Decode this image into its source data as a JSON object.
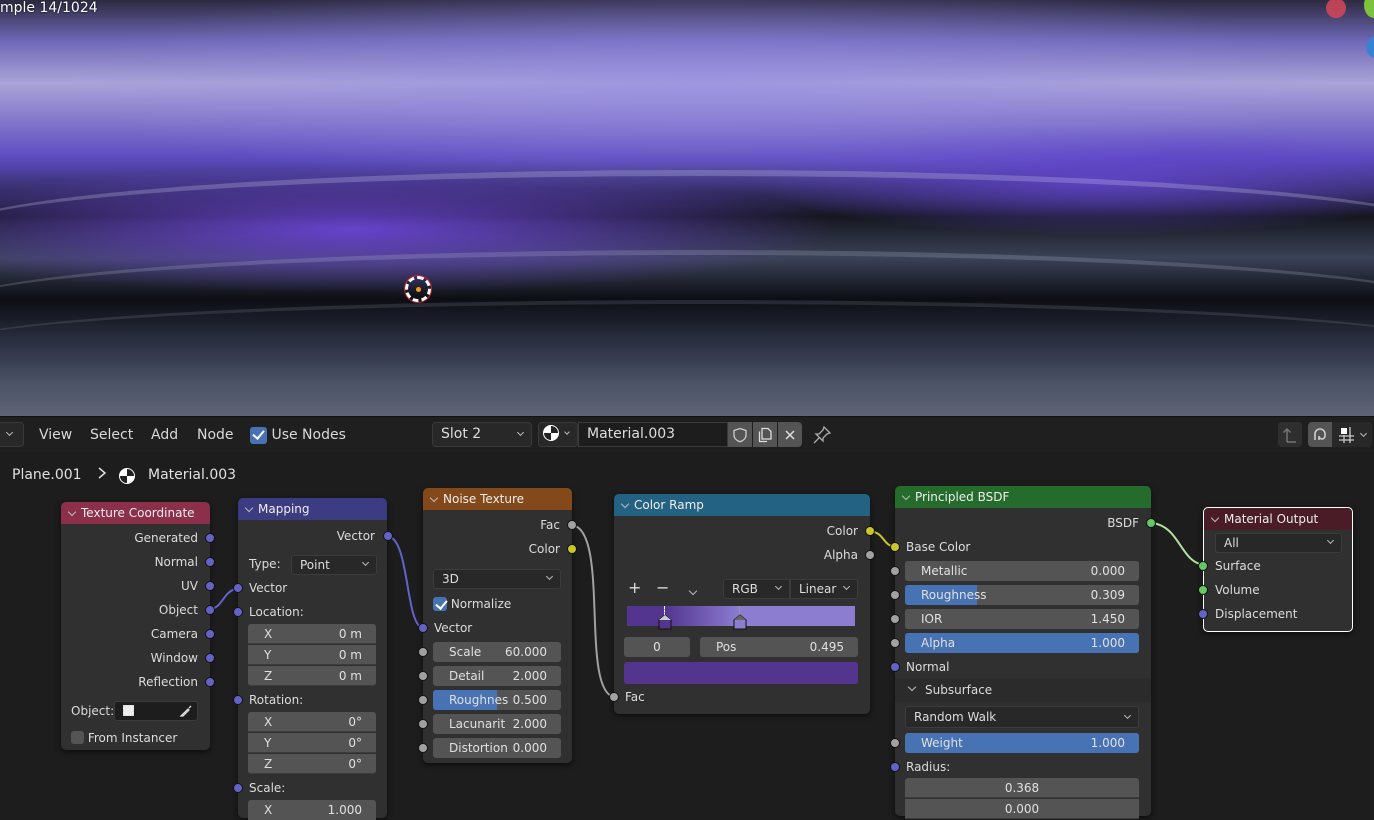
{
  "viewport": {
    "sample_text": "mple 14/1024",
    "gizmo": {
      "x_color": "#d3475a",
      "y_color": "#7cc23c",
      "z_color": "#3d7fd0"
    }
  },
  "header": {
    "menus": [
      "View",
      "Select",
      "Add",
      "Node"
    ],
    "use_nodes_label": "Use Nodes",
    "use_nodes_checked": true,
    "slot": "Slot 2",
    "material_name": "Material.003"
  },
  "breadcrumb": {
    "object": "Plane.001",
    "material": "Material.003"
  },
  "nodes": {
    "texture_coordinate": {
      "title": "Texture Coordinate",
      "header_color": "#8b2f4b",
      "outputs": [
        "Generated",
        "Normal",
        "UV",
        "Object",
        "Camera",
        "Window",
        "Reflection"
      ],
      "object_label": "Object:",
      "from_instancer_label": "From Instancer",
      "from_instancer_checked": false
    },
    "mapping": {
      "title": "Mapping",
      "header_color": "#3c3c83",
      "output": "Vector",
      "type_label": "Type:",
      "type_value": "Point",
      "vector_input": "Vector",
      "location_label": "Location:",
      "location": [
        {
          "axis": "X",
          "value": "0 m"
        },
        {
          "axis": "Y",
          "value": "0 m"
        },
        {
          "axis": "Z",
          "value": "0 m"
        }
      ],
      "rotation_label": "Rotation:",
      "rotation": [
        {
          "axis": "X",
          "value": "0°"
        },
        {
          "axis": "Y",
          "value": "0°"
        },
        {
          "axis": "Z",
          "value": "0°"
        }
      ],
      "scale_label": "Scale:",
      "scale_x": {
        "axis": "X",
        "value": "1.000"
      }
    },
    "noise_texture": {
      "title": "Noise Texture",
      "header_color": "#83491a",
      "outputs": [
        "Fac",
        "Color"
      ],
      "dimension": "3D",
      "normalize_label": "Normalize",
      "normalize_checked": true,
      "vector_input": "Vector",
      "fields": [
        {
          "label": "Scale",
          "value": "60.000"
        },
        {
          "label": "Detail",
          "value": "2.000"
        },
        {
          "label": "Roughnes",
          "value": "0.500",
          "fill": 0.5
        },
        {
          "label": "Lacunarit",
          "value": "2.000"
        },
        {
          "label": "Distortion",
          "value": "0.000"
        }
      ]
    },
    "color_ramp": {
      "title": "Color Ramp",
      "header_color": "#246283",
      "outputs": [
        "Color",
        "Alpha"
      ],
      "add_label": "+",
      "remove_label": "−",
      "color_mode": "RGB",
      "interpolation": "Linear",
      "stops": [
        {
          "position": 0.167,
          "color": "#53358f"
        },
        {
          "position": 0.495,
          "color": "#8c7dd1"
        }
      ],
      "ramp_colors": {
        "left": "#53358f",
        "right": "#8c7dd1"
      },
      "active_index": "0",
      "pos_label": "Pos",
      "pos_value": "0.495",
      "active_color": "#53358f",
      "fac_input": "Fac"
    },
    "principled_bsdf": {
      "title": "Principled BSDF",
      "header_color": "#246b2c",
      "output": "BSDF",
      "base_color_label": "Base Color",
      "fields": [
        {
          "label": "Metallic",
          "value": "0.000",
          "fill": 0
        },
        {
          "label": "Roughness",
          "value": "0.309",
          "fill": 0.309
        },
        {
          "label": "IOR",
          "value": "1.450",
          "fill": 0
        },
        {
          "label": "Alpha",
          "value": "1.000",
          "fill": 1
        }
      ],
      "normal_label": "Normal",
      "subsurface_label": "Subsurface",
      "subsurface_method": "Random Walk",
      "weight": {
        "label": "Weight",
        "value": "1.000",
        "fill": 1
      },
      "radius_label": "Radius:",
      "radius_values": [
        "0.368",
        "0.000"
      ]
    },
    "material_output": {
      "title": "Material Output",
      "header_color": "#4a1c26",
      "target": "All",
      "inputs": [
        "Surface",
        "Volume",
        "Displacement"
      ]
    }
  }
}
